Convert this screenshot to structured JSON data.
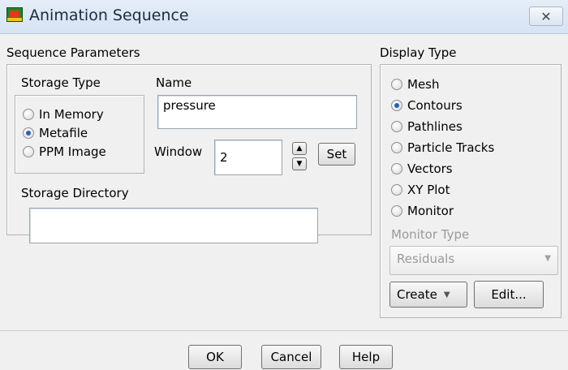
{
  "window": {
    "title": "Animation Sequence",
    "close_glyph": "✕"
  },
  "sequence_parameters": {
    "label": "Sequence Parameters",
    "storage_type": {
      "label": "Storage Type",
      "options": [
        "In Memory",
        "Metafile",
        "PPM Image"
      ],
      "selected": "Metafile"
    },
    "name": {
      "label": "Name",
      "value": "pressure"
    },
    "window_field": {
      "label": "Window",
      "value": "2",
      "set_label": "Set"
    },
    "storage_directory": {
      "label": "Storage Directory",
      "value": ""
    }
  },
  "display_type": {
    "label": "Display Type",
    "options": [
      "Mesh",
      "Contours",
      "Pathlines",
      "Particle Tracks",
      "Vectors",
      "XY Plot",
      "Monitor"
    ],
    "selected": "Contours",
    "monitor_type": {
      "label": "Monitor Type",
      "value": "Residuals"
    },
    "create_label": "Create",
    "edit_label": "Edit..."
  },
  "footer": {
    "ok": "OK",
    "cancel": "Cancel",
    "help": "Help"
  },
  "icons": {
    "spin_up": "▲",
    "spin_down": "▼",
    "dropdown": "▼"
  }
}
